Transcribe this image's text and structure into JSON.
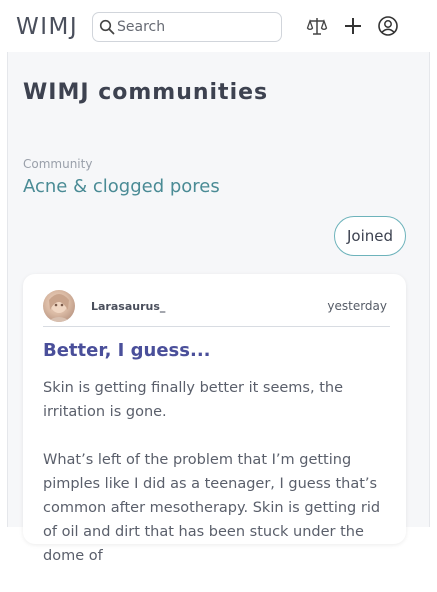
{
  "header": {
    "logo": "WIMJ",
    "search_placeholder": "Search",
    "icons": [
      "balance-scale-icon",
      "plus-icon",
      "user-account-icon"
    ]
  },
  "page": {
    "title": "WIMJ communities",
    "community_label": "Community",
    "community_name": "Acne & clogged pores",
    "joined_label": "Joined"
  },
  "post": {
    "author": "Larasaurus_",
    "time": "yesterday",
    "title": "Better, I guess...",
    "paragraph1": "Skin is getting finally better it seems, the irritation is gone.",
    "paragraph2": "What’s left of the problem that I’m getting pimples like I did as a teenager, I guess that’s common after mesotherapy. Skin is getting rid of oil and dirt that has been stuck under the dome of"
  },
  "colors": {
    "accent": "#4a8b95",
    "title": "#4a4f9a",
    "button_border": "#6db3bb"
  }
}
